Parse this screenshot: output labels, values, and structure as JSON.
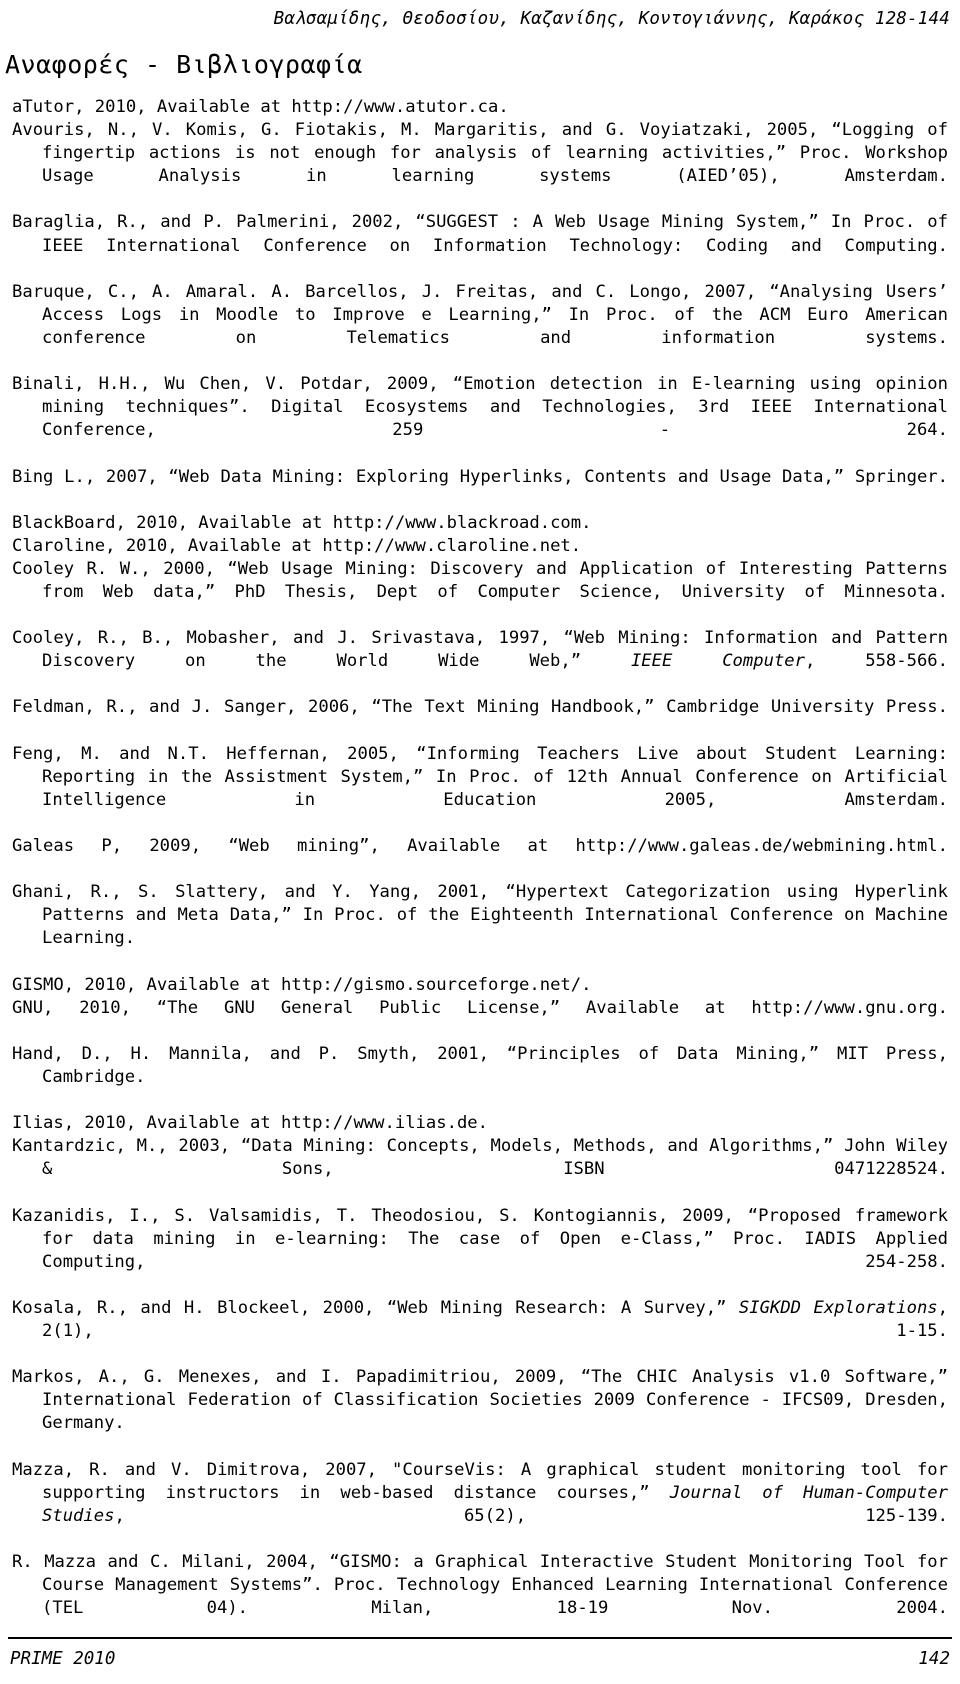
{
  "header": {
    "running_head": "Βαλσαμίδης, Θεοδοσίου, Καζανίδης, Κοντογιάννης, Καράκος 128-144"
  },
  "title": "Αναφορές - Βιβλιογραφία",
  "references": [
    {
      "id": "atutor",
      "text": "aTutor, 2010, Available at http://www.atutor.ca.",
      "justified": false
    },
    {
      "id": "avouris",
      "text": "Avouris, N., V. Komis, G. Fiotakis, M. Margaritis, and G. Voyiatzaki, 2005, “Logging of fingertip actions is not enough for analysis of learning activities,” Proc. Workshop Usage Analysis in learning systems (AIED’05), Amsterdam.",
      "justified": true
    },
    {
      "id": "baraglia",
      "text": "Baraglia, R., and P. Palmerini, 2002, “SUGGEST : A Web Usage Mining System,” In Proc. of IEEE International Conference on Information Technology: Coding and Computing.",
      "justified": true
    },
    {
      "id": "baruque",
      "text": "Baruque, C., A. Amaral. A. Barcellos, J. Freitas, and C. Longo, 2007, “Analysing Users’ Access Logs in Moodle to Improve e Learning,” In Proc. of the ACM Euro American conference on Telematics and information systems.",
      "justified": true
    },
    {
      "id": "binali",
      "text": "Binali, H.H., Wu Chen, V. Potdar, 2009, “Emotion detection in E-learning using opinion mining techniques”. Digital Ecosystems and Technologies, 3rd IEEE International Conference, 259 - 264.",
      "justified": true
    },
    {
      "id": "bing",
      "text": "Bing L., 2007, “Web Data Mining: Exploring Hyperlinks, Contents and Usage Data,” Springer.",
      "justified": true
    },
    {
      "id": "blackboard",
      "text": "BlackBoard, 2010, Available at http://www.blackroad.com.",
      "justified": false
    },
    {
      "id": "claroline",
      "text": "Claroline, 2010, Available at http://www.claroline.net.",
      "justified": false
    },
    {
      "id": "cooley2000",
      "text": "Cooley R. W., 2000, “Web Usage Mining: Discovery and Application of Interesting Patterns from Web data,” PhD Thesis, Dept of Computer Science, University of Minnesota.",
      "justified": true
    },
    {
      "id": "cooley1997",
      "text_parts": [
        {
          "t": "Cooley, R., B., Mobasher, and J. Srivastava, 1997, “Web Mining: Information and Pattern Discovery on the World Wide Web,” ",
          "italic": false
        },
        {
          "t": "IEEE Computer",
          "italic": true
        },
        {
          "t": ", 558-566.",
          "italic": false
        }
      ],
      "justified": true
    },
    {
      "id": "feldman",
      "text": "Feldman, R., and J. Sanger, 2006, “The Text Mining Handbook,” Cambridge University Press.",
      "justified": true
    },
    {
      "id": "feng",
      "text": "Feng, M. and N.T. Heffernan, 2005, “Informing Teachers Live about Student Learning: Reporting in the Assistment System,” In Proc. of 12th Annual Conference on Artificial Intelligence in Education 2005, Amsterdam.",
      "justified": true
    },
    {
      "id": "galeas",
      "text": "Galeas P, 2009, “Web mining”, Available at http://www.galeas.de/webmining.html.",
      "justified": true
    },
    {
      "id": "ghani",
      "text": "Ghani, R., S. Slattery, and Y. Yang, 2001, “Hypertext Categorization using Hyperlink Patterns and Meta Data,” In Proc. of the Eighteenth International Conference on Machine Learning.",
      "justified": true
    },
    {
      "id": "gismo",
      "text": "GISMO, 2010, Available at http://gismo.sourceforge.net/.",
      "justified": false
    },
    {
      "id": "gnu",
      "text": "GNU, 2010, “The GNU General Public License,” Available at http://www.gnu.org.",
      "justified": true
    },
    {
      "id": "hand",
      "text": "Hand, D., H. Mannila, and P. Smyth, 2001, “Principles of Data Mining,” MIT Press, Cambridge.",
      "justified": true
    },
    {
      "id": "ilias",
      "text": "Ilias, 2010, Available at http://www.ilias.de.",
      "justified": false
    },
    {
      "id": "kantardzic",
      "text": "Kantardzic, M., 2003, “Data Mining: Concepts, Models, Methods, and Algorithms,” John Wiley & Sons, ISBN 0471228524.",
      "justified": true
    },
    {
      "id": "kazanidis",
      "text": "Kazanidis, I., S. Valsamidis, T. Theodosiou, S. Kontogiannis, 2009, “Proposed framework for data mining in e-learning: The case of Open e-Class,” Proc. IADIS Applied Computing, 254-258.",
      "justified": true
    },
    {
      "id": "kosala",
      "text_parts": [
        {
          "t": "Kosala, R., and H. Blockeel, 2000, “Web Mining Research: A Survey,” ",
          "italic": false
        },
        {
          "t": "SIGKDD Explorations",
          "italic": true
        },
        {
          "t": ", 2(1), 1-15.",
          "italic": false
        }
      ],
      "justified": true
    },
    {
      "id": "markos",
      "text": "Markos, A., G. Menexes, and I. Papadimitriou, 2009, “The CHIC Analysis v1.0 Software,” International Federation of Classification Societies 2009 Conference - IFCS09, Dresden, Germany.",
      "justified": true
    },
    {
      "id": "mazza2007",
      "text_parts": [
        {
          "t": "Mazza, R. and V. Dimitrova, 2007, \"CourseVis: A graphical student monitoring tool for supporting instructors in web-based distance courses,” ",
          "italic": false
        },
        {
          "t": "Journal of Human-Computer Studies",
          "italic": true
        },
        {
          "t": ", 65(2), 125-139.",
          "italic": false
        }
      ],
      "justified": true
    },
    {
      "id": "mazza2004",
      "text": "R. Mazza and C. Milani, 2004, “GISMO: a Graphical Interactive Student Monitoring Tool for Course Management Systems”. Proc. Technology Enhanced Learning International Conference (TEL 04). Milan, 18-19 Nov. 2004.",
      "justified": true
    }
  ],
  "footer": {
    "left": "PRIME 2010",
    "right": "142"
  }
}
